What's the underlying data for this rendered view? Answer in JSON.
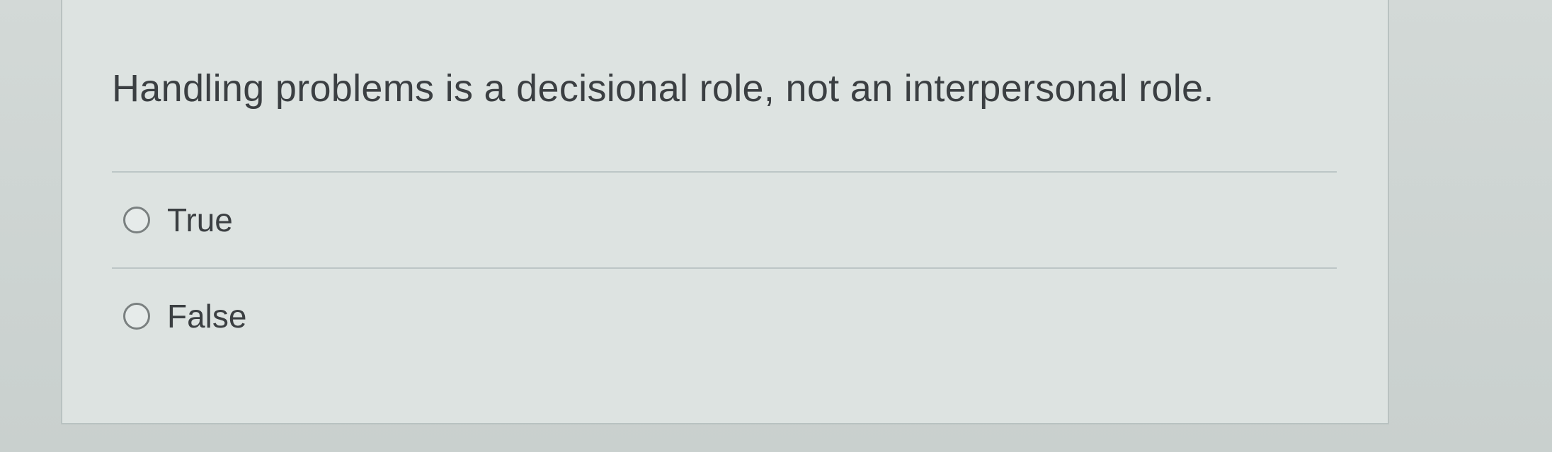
{
  "question": {
    "text": "Handling problems is a decisional role, not an interpersonal role."
  },
  "options": [
    {
      "label": "True",
      "selected": false
    },
    {
      "label": "False",
      "selected": false
    }
  ],
  "colors": {
    "text": "#3b3f42",
    "card_background": "#dde3e1",
    "border": "#b9c2c1"
  }
}
